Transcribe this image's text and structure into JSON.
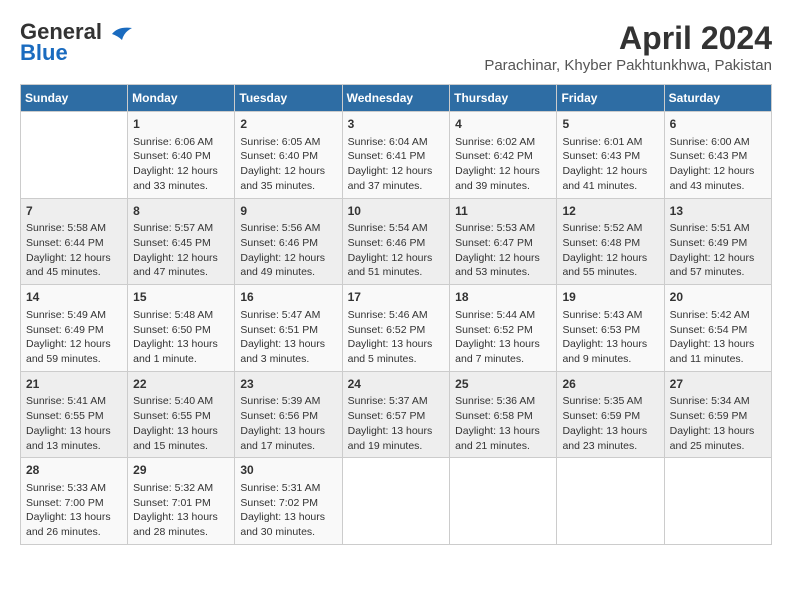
{
  "header": {
    "logo_general": "General",
    "logo_blue": "Blue",
    "month": "April 2024",
    "location": "Parachinar, Khyber Pakhtunkhwa, Pakistan"
  },
  "columns": [
    "Sunday",
    "Monday",
    "Tuesday",
    "Wednesday",
    "Thursday",
    "Friday",
    "Saturday"
  ],
  "weeks": [
    [
      {
        "day": "",
        "lines": []
      },
      {
        "day": "1",
        "lines": [
          "Sunrise: 6:06 AM",
          "Sunset: 6:40 PM",
          "Daylight: 12 hours",
          "and 33 minutes."
        ]
      },
      {
        "day": "2",
        "lines": [
          "Sunrise: 6:05 AM",
          "Sunset: 6:40 PM",
          "Daylight: 12 hours",
          "and 35 minutes."
        ]
      },
      {
        "day": "3",
        "lines": [
          "Sunrise: 6:04 AM",
          "Sunset: 6:41 PM",
          "Daylight: 12 hours",
          "and 37 minutes."
        ]
      },
      {
        "day": "4",
        "lines": [
          "Sunrise: 6:02 AM",
          "Sunset: 6:42 PM",
          "Daylight: 12 hours",
          "and 39 minutes."
        ]
      },
      {
        "day": "5",
        "lines": [
          "Sunrise: 6:01 AM",
          "Sunset: 6:43 PM",
          "Daylight: 12 hours",
          "and 41 minutes."
        ]
      },
      {
        "day": "6",
        "lines": [
          "Sunrise: 6:00 AM",
          "Sunset: 6:43 PM",
          "Daylight: 12 hours",
          "and 43 minutes."
        ]
      }
    ],
    [
      {
        "day": "7",
        "lines": [
          "Sunrise: 5:58 AM",
          "Sunset: 6:44 PM",
          "Daylight: 12 hours",
          "and 45 minutes."
        ]
      },
      {
        "day": "8",
        "lines": [
          "Sunrise: 5:57 AM",
          "Sunset: 6:45 PM",
          "Daylight: 12 hours",
          "and 47 minutes."
        ]
      },
      {
        "day": "9",
        "lines": [
          "Sunrise: 5:56 AM",
          "Sunset: 6:46 PM",
          "Daylight: 12 hours",
          "and 49 minutes."
        ]
      },
      {
        "day": "10",
        "lines": [
          "Sunrise: 5:54 AM",
          "Sunset: 6:46 PM",
          "Daylight: 12 hours",
          "and 51 minutes."
        ]
      },
      {
        "day": "11",
        "lines": [
          "Sunrise: 5:53 AM",
          "Sunset: 6:47 PM",
          "Daylight: 12 hours",
          "and 53 minutes."
        ]
      },
      {
        "day": "12",
        "lines": [
          "Sunrise: 5:52 AM",
          "Sunset: 6:48 PM",
          "Daylight: 12 hours",
          "and 55 minutes."
        ]
      },
      {
        "day": "13",
        "lines": [
          "Sunrise: 5:51 AM",
          "Sunset: 6:49 PM",
          "Daylight: 12 hours",
          "and 57 minutes."
        ]
      }
    ],
    [
      {
        "day": "14",
        "lines": [
          "Sunrise: 5:49 AM",
          "Sunset: 6:49 PM",
          "Daylight: 12 hours",
          "and 59 minutes."
        ]
      },
      {
        "day": "15",
        "lines": [
          "Sunrise: 5:48 AM",
          "Sunset: 6:50 PM",
          "Daylight: 13 hours",
          "and 1 minute."
        ]
      },
      {
        "day": "16",
        "lines": [
          "Sunrise: 5:47 AM",
          "Sunset: 6:51 PM",
          "Daylight: 13 hours",
          "and 3 minutes."
        ]
      },
      {
        "day": "17",
        "lines": [
          "Sunrise: 5:46 AM",
          "Sunset: 6:52 PM",
          "Daylight: 13 hours",
          "and 5 minutes."
        ]
      },
      {
        "day": "18",
        "lines": [
          "Sunrise: 5:44 AM",
          "Sunset: 6:52 PM",
          "Daylight: 13 hours",
          "and 7 minutes."
        ]
      },
      {
        "day": "19",
        "lines": [
          "Sunrise: 5:43 AM",
          "Sunset: 6:53 PM",
          "Daylight: 13 hours",
          "and 9 minutes."
        ]
      },
      {
        "day": "20",
        "lines": [
          "Sunrise: 5:42 AM",
          "Sunset: 6:54 PM",
          "Daylight: 13 hours",
          "and 11 minutes."
        ]
      }
    ],
    [
      {
        "day": "21",
        "lines": [
          "Sunrise: 5:41 AM",
          "Sunset: 6:55 PM",
          "Daylight: 13 hours",
          "and 13 minutes."
        ]
      },
      {
        "day": "22",
        "lines": [
          "Sunrise: 5:40 AM",
          "Sunset: 6:55 PM",
          "Daylight: 13 hours",
          "and 15 minutes."
        ]
      },
      {
        "day": "23",
        "lines": [
          "Sunrise: 5:39 AM",
          "Sunset: 6:56 PM",
          "Daylight: 13 hours",
          "and 17 minutes."
        ]
      },
      {
        "day": "24",
        "lines": [
          "Sunrise: 5:37 AM",
          "Sunset: 6:57 PM",
          "Daylight: 13 hours",
          "and 19 minutes."
        ]
      },
      {
        "day": "25",
        "lines": [
          "Sunrise: 5:36 AM",
          "Sunset: 6:58 PM",
          "Daylight: 13 hours",
          "and 21 minutes."
        ]
      },
      {
        "day": "26",
        "lines": [
          "Sunrise: 5:35 AM",
          "Sunset: 6:59 PM",
          "Daylight: 13 hours",
          "and 23 minutes."
        ]
      },
      {
        "day": "27",
        "lines": [
          "Sunrise: 5:34 AM",
          "Sunset: 6:59 PM",
          "Daylight: 13 hours",
          "and 25 minutes."
        ]
      }
    ],
    [
      {
        "day": "28",
        "lines": [
          "Sunrise: 5:33 AM",
          "Sunset: 7:00 PM",
          "Daylight: 13 hours",
          "and 26 minutes."
        ]
      },
      {
        "day": "29",
        "lines": [
          "Sunrise: 5:32 AM",
          "Sunset: 7:01 PM",
          "Daylight: 13 hours",
          "and 28 minutes."
        ]
      },
      {
        "day": "30",
        "lines": [
          "Sunrise: 5:31 AM",
          "Sunset: 7:02 PM",
          "Daylight: 13 hours",
          "and 30 minutes."
        ]
      },
      {
        "day": "",
        "lines": []
      },
      {
        "day": "",
        "lines": []
      },
      {
        "day": "",
        "lines": []
      },
      {
        "day": "",
        "lines": []
      }
    ]
  ]
}
